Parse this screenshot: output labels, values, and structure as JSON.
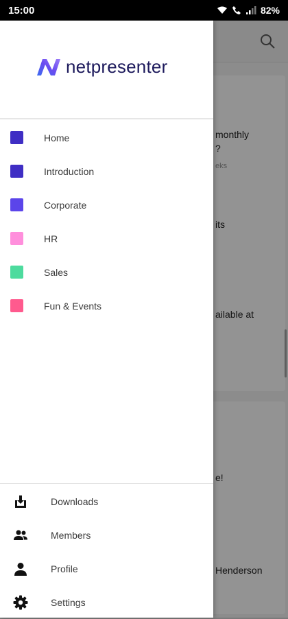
{
  "status_bar": {
    "time": "15:00",
    "battery": "82%"
  },
  "drawer": {
    "logo_text": "netpresenter",
    "nav_items": [
      {
        "label": "Home",
        "color": "#3f2ec4"
      },
      {
        "label": "Introduction",
        "color": "#3f2ec4"
      },
      {
        "label": "Corporate",
        "color": "#5b45ea"
      },
      {
        "label": "HR",
        "color": "#ff8fdc"
      },
      {
        "label": "Sales",
        "color": "#4ddb9e"
      },
      {
        "label": "Fun & Events",
        "color": "#ff5a8e"
      }
    ],
    "bottom_items": [
      {
        "label": "Downloads",
        "icon": "download-icon"
      },
      {
        "label": "Members",
        "icon": "members-icon"
      },
      {
        "label": "Profile",
        "icon": "profile-icon"
      },
      {
        "label": "Settings",
        "icon": "settings-icon"
      }
    ]
  },
  "background": {
    "texts": [
      "monthly",
      "?",
      "eks",
      "its",
      "ailable at",
      "e!",
      "Henderson"
    ]
  }
}
